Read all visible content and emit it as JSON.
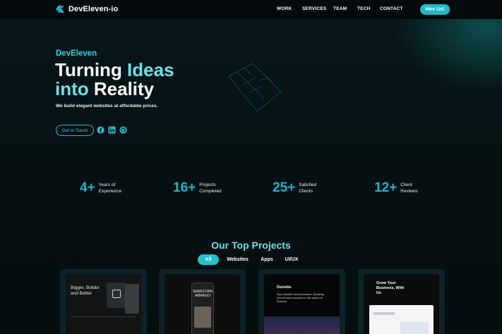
{
  "brand": {
    "name": "DevEleven-io",
    "hero_name": "DevEleven"
  },
  "nav": {
    "items": [
      "WORK",
      "SERVICES",
      "TEAM",
      "TECH",
      "CONTACT"
    ],
    "hire": "Hire Us!"
  },
  "hero": {
    "title_line1_a": "Turning ",
    "title_line1_b": "Ideas",
    "title_line2_a": "into",
    "title_line2_b": " Reality",
    "tagline": "We build elegant websites at affordable prices.",
    "cta": "Get In Touch",
    "social": [
      "facebook-icon",
      "linkedin-icon",
      "github-icon"
    ]
  },
  "stats": [
    {
      "num": "4+",
      "l1": "Years of",
      "l2": "Experience"
    },
    {
      "num": "16+",
      "l1": "Projects",
      "l2": "Completed"
    },
    {
      "num": "25+",
      "l1": "Satisfied",
      "l2": "Clients"
    },
    {
      "num": "12+",
      "l1": "Client",
      "l2": "Reviews"
    }
  ],
  "projects": {
    "title": "Our Top Projects",
    "filters": [
      "All",
      "Websites",
      "Apps",
      "UI/UX"
    ],
    "active_filter": "All",
    "cards": [
      {
        "heading": "Bigger, Bolder and Better"
      },
      {
        "heading": "SEBASTIAN AMARGO"
      },
      {
        "heading": "Deloitte.",
        "sub": "How Deloitte found freedom, flexibility, and rebrand success to the switch to Dotadio"
      },
      {
        "heading": "Grow Your Business, With Us"
      }
    ]
  },
  "colors": {
    "accent": "#24c1cf",
    "accent_light": "#6fe0e6",
    "background": "#061012"
  }
}
